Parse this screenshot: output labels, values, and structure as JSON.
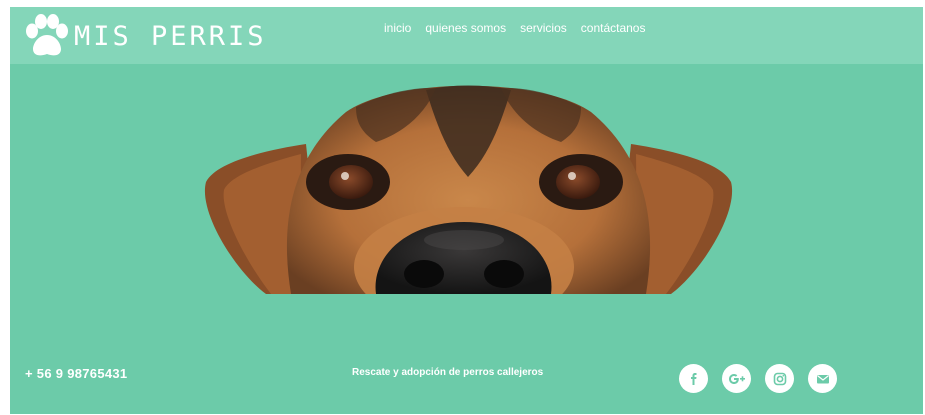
{
  "brand": {
    "name": "MIS PERRIS"
  },
  "nav": {
    "items": [
      {
        "label": "inicio"
      },
      {
        "label": "quienes somos"
      },
      {
        "label": "servicios"
      },
      {
        "label": "contáctanos"
      }
    ]
  },
  "hero": {
    "image": "dog-peeking-photo"
  },
  "footer": {
    "phone": "+ 56 9 98765431",
    "tagline": "Rescate y adopción de perros callejeros",
    "social": [
      {
        "icon": "facebook-icon"
      },
      {
        "icon": "google-plus-icon"
      },
      {
        "icon": "instagram-icon"
      },
      {
        "icon": "email-icon"
      }
    ]
  },
  "colors": {
    "background": "#6ccba9",
    "navbar": "#84d6b9",
    "text": "#ffffff",
    "social_icon": "#6ccba9"
  }
}
